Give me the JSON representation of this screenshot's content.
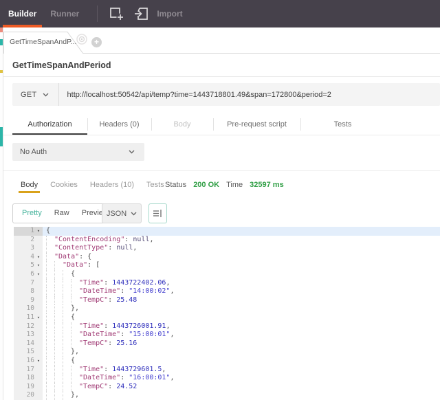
{
  "colors": {
    "orange": "#ef5b25",
    "green": "#2f9e44",
    "amber": "#d9a21b",
    "teal": "#45b39c",
    "key": "#a03a74",
    "topbar_bg": "#46414b"
  },
  "topbar": {
    "builder": "Builder",
    "runner": "Runner",
    "import_label": "Import"
  },
  "tabstrip": {
    "tab_label": "GetTimeSpanAndP...",
    "plus": "+"
  },
  "request": {
    "title": "GetTimeSpanAndPeriod",
    "method": "GET",
    "url": "http://localhost:50542/api/temp?time=1443718801.49&span=172800&period=2",
    "tabs": [
      {
        "label": "Authorization",
        "state": "active"
      },
      {
        "label": "Headers (0)",
        "state": ""
      },
      {
        "label": "Body",
        "state": "disabled"
      },
      {
        "label": "Pre-request script",
        "state": ""
      },
      {
        "label": "Tests",
        "state": ""
      }
    ],
    "auth_value": "No Auth"
  },
  "response": {
    "tabs": [
      {
        "label": "Body",
        "active": true
      },
      {
        "label": "Cookies",
        "active": false
      },
      {
        "label": "Headers (10)",
        "active": false
      },
      {
        "label": "Tests",
        "active": false
      }
    ],
    "status_label": "Status",
    "status_value": "200 OK",
    "time_label": "Time",
    "time_value": "32597 ms",
    "view_buttons": [
      {
        "label": "Pretty",
        "active": true
      },
      {
        "label": "Raw",
        "active": false
      },
      {
        "label": "Preview",
        "active": false
      }
    ],
    "format": "JSON"
  },
  "editor": {
    "active_line": 1,
    "lines": [
      {
        "n": 1,
        "fold": true,
        "indent": 0,
        "tokens": [
          [
            "p",
            "{"
          ]
        ]
      },
      {
        "n": 2,
        "indent": 2,
        "tokens": [
          [
            "k",
            "\"ContentEncoding\""
          ],
          [
            "p",
            ": "
          ],
          [
            "u",
            "null"
          ],
          [
            "p",
            ","
          ]
        ]
      },
      {
        "n": 3,
        "indent": 2,
        "tokens": [
          [
            "k",
            "\"ContentType\""
          ],
          [
            "p",
            ": "
          ],
          [
            "u",
            "null"
          ],
          [
            "p",
            ","
          ]
        ]
      },
      {
        "n": 4,
        "fold": true,
        "indent": 2,
        "tokens": [
          [
            "k",
            "\"Data\""
          ],
          [
            "p",
            ": {"
          ]
        ]
      },
      {
        "n": 5,
        "fold": true,
        "indent": 4,
        "tokens": [
          [
            "k",
            "\"Data\""
          ],
          [
            "p",
            ": ["
          ]
        ]
      },
      {
        "n": 6,
        "fold": true,
        "indent": 6,
        "tokens": [
          [
            "p",
            "{"
          ]
        ]
      },
      {
        "n": 7,
        "indent": 8,
        "tokens": [
          [
            "k",
            "\"Time\""
          ],
          [
            "p",
            ": "
          ],
          [
            "n",
            "1443722402.06"
          ],
          [
            "p",
            ","
          ]
        ]
      },
      {
        "n": 8,
        "indent": 8,
        "tokens": [
          [
            "k",
            "\"DateTime\""
          ],
          [
            "p",
            ": "
          ],
          [
            "s",
            "\"14:00:02\""
          ],
          [
            "p",
            ","
          ]
        ]
      },
      {
        "n": 9,
        "indent": 8,
        "tokens": [
          [
            "k",
            "\"TempC\""
          ],
          [
            "p",
            ": "
          ],
          [
            "n",
            "25.48"
          ]
        ]
      },
      {
        "n": 10,
        "indent": 6,
        "tokens": [
          [
            "p",
            "},"
          ]
        ]
      },
      {
        "n": 11,
        "fold": true,
        "indent": 6,
        "tokens": [
          [
            "p",
            "{"
          ]
        ]
      },
      {
        "n": 12,
        "indent": 8,
        "tokens": [
          [
            "k",
            "\"Time\""
          ],
          [
            "p",
            ": "
          ],
          [
            "n",
            "1443726001.91"
          ],
          [
            "p",
            ","
          ]
        ]
      },
      {
        "n": 13,
        "indent": 8,
        "tokens": [
          [
            "k",
            "\"DateTime\""
          ],
          [
            "p",
            ": "
          ],
          [
            "s",
            "\"15:00:01\""
          ],
          [
            "p",
            ","
          ]
        ]
      },
      {
        "n": 14,
        "indent": 8,
        "tokens": [
          [
            "k",
            "\"TempC\""
          ],
          [
            "p",
            ": "
          ],
          [
            "n",
            "25.16"
          ]
        ]
      },
      {
        "n": 15,
        "indent": 6,
        "tokens": [
          [
            "p",
            "},"
          ]
        ]
      },
      {
        "n": 16,
        "fold": true,
        "indent": 6,
        "tokens": [
          [
            "p",
            "{"
          ]
        ]
      },
      {
        "n": 17,
        "indent": 8,
        "tokens": [
          [
            "k",
            "\"Time\""
          ],
          [
            "p",
            ": "
          ],
          [
            "n",
            "1443729601.5"
          ],
          [
            "p",
            ","
          ]
        ]
      },
      {
        "n": 18,
        "indent": 8,
        "tokens": [
          [
            "k",
            "\"DateTime\""
          ],
          [
            "p",
            ": "
          ],
          [
            "s",
            "\"16:00:01\""
          ],
          [
            "p",
            ","
          ]
        ]
      },
      {
        "n": 19,
        "indent": 8,
        "tokens": [
          [
            "k",
            "\"TempC\""
          ],
          [
            "p",
            ": "
          ],
          [
            "n",
            "24.52"
          ]
        ]
      },
      {
        "n": 20,
        "indent": 6,
        "tokens": [
          [
            "p",
            "},"
          ]
        ]
      }
    ]
  }
}
